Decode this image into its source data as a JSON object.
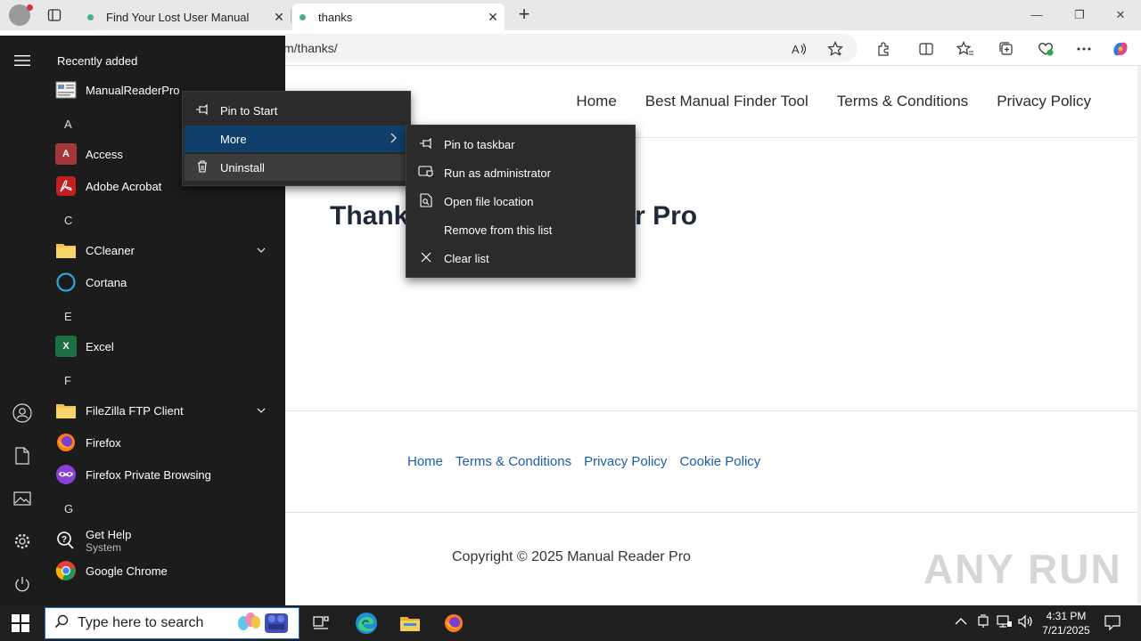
{
  "browser": {
    "tabs": [
      {
        "title": "Find Your Lost User Manual"
      },
      {
        "title": "thanks"
      }
    ],
    "new_tab": "+",
    "url_visible": "m/thanks/",
    "window_controls": {
      "minimize": "—",
      "restore": "❐",
      "close": "✕"
    }
  },
  "site": {
    "nav": [
      "Home",
      "Best Manual Finder Tool",
      "Terms & Conditions",
      "Privacy Policy"
    ],
    "hero_left": "Thank",
    "hero_right": "ual Reader Pro",
    "footer_links": [
      "Home",
      "Terms & Conditions",
      "Privacy Policy",
      "Cookie Policy"
    ],
    "copyright": "Copyright © 2025 Manual Reader Pro",
    "watermark": "ANY RUN"
  },
  "start_menu": {
    "recent_title": "Recently added",
    "apps": [
      {
        "name": "ManualReaderPro",
        "icon": "manualreaderpro-icon"
      },
      {
        "letter": "A"
      },
      {
        "name": "Access",
        "icon": "access-icon"
      },
      {
        "name": "Adobe Acrobat",
        "icon": "acrobat-icon"
      },
      {
        "letter": "C"
      },
      {
        "name": "CCleaner",
        "icon": "folder-icon",
        "expand": true
      },
      {
        "name": "Cortana",
        "icon": "cortana-icon"
      },
      {
        "letter": "E"
      },
      {
        "name": "Excel",
        "icon": "excel-icon"
      },
      {
        "letter": "F"
      },
      {
        "name": "FileZilla FTP Client",
        "icon": "folder-icon",
        "expand": true
      },
      {
        "name": "Firefox",
        "icon": "firefox-icon"
      },
      {
        "name": "Firefox Private Browsing",
        "icon": "firefox-private-icon"
      },
      {
        "letter": "G"
      },
      {
        "name": "Get Help",
        "sub": "System",
        "icon": "get-help-icon"
      },
      {
        "name": "Google Chrome",
        "icon": "chrome-icon"
      }
    ],
    "access_letter": "A",
    "excel_letter": "X"
  },
  "context_menu": {
    "items": [
      {
        "label": "Pin to Start",
        "icon": "pin-icon"
      },
      {
        "label": "More",
        "icon": "",
        "submenu": true
      },
      {
        "label": "Uninstall",
        "icon": "trash-icon"
      }
    ],
    "arrow": "›"
  },
  "submenu": {
    "items": [
      {
        "label": "Pin to taskbar",
        "icon": "pin-icon"
      },
      {
        "label": "Run as administrator",
        "icon": "shield-icon"
      },
      {
        "label": "Open file location",
        "icon": "file-location-icon"
      },
      {
        "label": "Remove from this list",
        "icon": ""
      },
      {
        "label": "Clear list",
        "icon": "close-icon"
      }
    ]
  },
  "taskbar": {
    "search_placeholder": "Type here to search",
    "time": "4:31 PM",
    "date": "7/21/2025"
  },
  "colors": {
    "start_bg": "#1c1c1c",
    "menu_bg": "#2b2b2b",
    "menu_highlight": "#0f3f6b",
    "link": "#1a5ea8",
    "taskbar": "#202020"
  }
}
